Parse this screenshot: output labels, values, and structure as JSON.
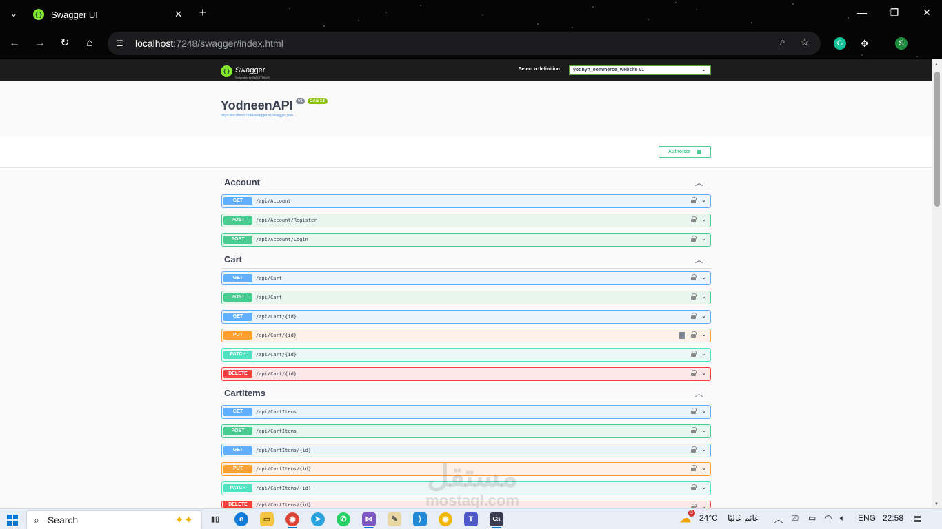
{
  "browser": {
    "tab_title": "Swagger UI",
    "url_host": "localhost",
    "url_rest": ":7248/swagger/index.html",
    "profile_initial": "S"
  },
  "swagger": {
    "logo_text": "Swagger",
    "logo_sub": "Supported by SMARTBEAR",
    "definition_label": "Select a definition",
    "definition_value": "yodnyn_eommerce_website v1",
    "api_title": "YodneenAPI",
    "version_badge": "v1",
    "oas_badge": "OAS 3.0",
    "spec_link": "https://localhost:7248/swagger/v1/swagger.json",
    "authorize_label": "Authorize"
  },
  "sections": [
    {
      "name": "Account",
      "ops": [
        {
          "method": "GET",
          "path": "/api/Account"
        },
        {
          "method": "POST",
          "path": "/api/Account/Register"
        },
        {
          "method": "POST",
          "path": "/api/Account/Login"
        }
      ]
    },
    {
      "name": "Cart",
      "ops": [
        {
          "method": "GET",
          "path": "/api/Cart"
        },
        {
          "method": "POST",
          "path": "/api/Cart"
        },
        {
          "method": "GET",
          "path": "/api/Cart/{id}"
        },
        {
          "method": "PUT",
          "path": "/api/Cart/{id}"
        },
        {
          "method": "PATCH",
          "path": "/api/Cart/{id}"
        },
        {
          "method": "DELETE",
          "path": "/api/Cart/{id}"
        }
      ]
    },
    {
      "name": "CartItems",
      "ops": [
        {
          "method": "GET",
          "path": "/api/CartItems"
        },
        {
          "method": "POST",
          "path": "/api/CartItems"
        },
        {
          "method": "GET",
          "path": "/api/CartItems/{id}"
        },
        {
          "method": "PUT",
          "path": "/api/CartItems/{id}"
        },
        {
          "method": "PATCH",
          "path": "/api/CartItems/{id}"
        },
        {
          "method": "DELETE",
          "path": "/api/CartItems/{id}"
        }
      ]
    }
  ],
  "watermark": {
    "line1": "مستقل",
    "line2": "mostaql.com"
  },
  "taskbar": {
    "search_placeholder": "Search",
    "weather_temp": "24°C",
    "weather_desc": "غائم غالبًا",
    "weather_badge": "3",
    "language": "ENG",
    "time": "22:58"
  },
  "colors": {
    "get": "#61affe",
    "post": "#49cc90",
    "put": "#fca130",
    "patch": "#50e3c2",
    "delete": "#f93e3e",
    "swagger_green": "#85ea2d"
  }
}
